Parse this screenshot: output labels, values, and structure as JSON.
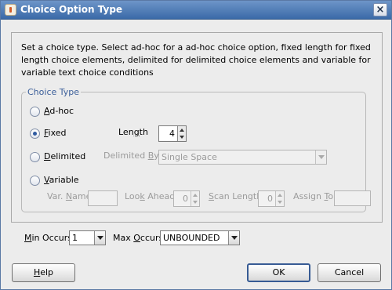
{
  "window": {
    "title": "Choice Option Type"
  },
  "description": "Set a choice type. Select ad-hoc for a ad-hoc choice option, fixed length for fixed length choice elements, delimited for delimited choice elements and variable for variable text choice conditions",
  "choice_type": {
    "legend": "Choice Type",
    "selected": "Fixed",
    "adhoc": {
      "mn": "A",
      "rest": "d-hoc"
    },
    "fixed": {
      "mn": "F",
      "rest": "ixed"
    },
    "delimited": {
      "mn": "D",
      "rest": "elimited"
    },
    "variable": {
      "mn": "V",
      "rest": "ariable"
    },
    "length": {
      "pre": "Len",
      "mn": "g",
      "post": "th",
      "value": "4"
    },
    "delimited_by": {
      "pre": "Delimited ",
      "mn": "B",
      "post": "y",
      "value": "Single Space"
    },
    "var_name": {
      "pre": "Var. ",
      "mn": "N",
      "post": "ame",
      "value": ""
    },
    "look_ahead": {
      "pre": "Loo",
      "mn": "k",
      "post": " Ahead",
      "value": "0"
    },
    "scan_length": {
      "pre": "",
      "mn": "S",
      "post": "can Length",
      "value": "0"
    },
    "assign_to": {
      "pre": "Assign ",
      "mn": "T",
      "post": "o",
      "value": ""
    }
  },
  "min_occurs": {
    "pre": "",
    "mn": "M",
    "post": "in Occurs",
    "value": "1"
  },
  "max_occurs": {
    "pre": "Max ",
    "mn": "O",
    "post": "ccurs",
    "value": "UNBOUNDED"
  },
  "buttons": {
    "help": {
      "mn": "H",
      "rest": "elp"
    },
    "ok": "OK",
    "cancel": "Cancel"
  }
}
